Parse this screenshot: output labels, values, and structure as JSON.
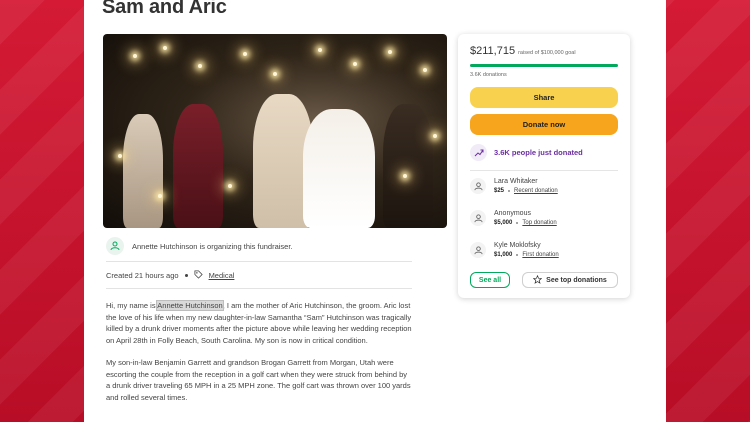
{
  "fundraiser": {
    "title": "Sam and Aric",
    "organizer_text": "Annette Hutchinson is organizing this fundraiser.",
    "created": "Created 21 hours ago",
    "category": "Medical",
    "story": {
      "p1_before": "Hi, my name is ",
      "p1_highlight": "Annette Hutchinson",
      "p1_after": ", I am the mother of Aric Hutchinson, the groom. Aric lost the love of his life when my new daughter-in-law Samantha “Sam” Hutchinson was tragically killed by a drunk driver moments after the picture above while leaving her wedding reception on April 28th in Folly Beach, South Carolina. My son is now in critical condition.",
      "p2": "My son-in-law Benjamin Garrett and grandson Brogan Garrett from Morgan, Utah were escorting the couple from the reception in a golf cart when they were struck from behind by a drunk driver traveling 65 MPH in a 25 MPH zone. The golf cart was thrown over 100 yards and rolled several times."
    }
  },
  "donation_card": {
    "raised": "$211,715",
    "goal": "raised of $100,000 goal",
    "progress_fraction": 1.0,
    "donations_count": "3.6K donations",
    "share_label": "Share",
    "donate_label": "Donate now",
    "just_donated": "3.6K people just donated",
    "donors": [
      {
        "name": "Lara Whitaker",
        "amount": "$25",
        "tag": "Recent donation"
      },
      {
        "name": "Anonymous",
        "amount": "$5,000",
        "tag": "Top donation"
      },
      {
        "name": "Kyle Moklofsky",
        "amount": "$1,000",
        "tag": "First donation"
      }
    ],
    "see_all_label": "See all",
    "see_top_label": "See top donations"
  },
  "colors": {
    "frame_red": "#c8102e",
    "progress_green": "#02a95c",
    "share_yellow": "#f8d24f",
    "donate_orange": "#f6a51c",
    "purple_text": "#6b2fa0"
  },
  "icons": {
    "organizer": "user-heart-icon",
    "category": "tag-icon",
    "trend": "trending-up-icon",
    "donor": "donor-heart-icon",
    "star": "star-icon"
  }
}
